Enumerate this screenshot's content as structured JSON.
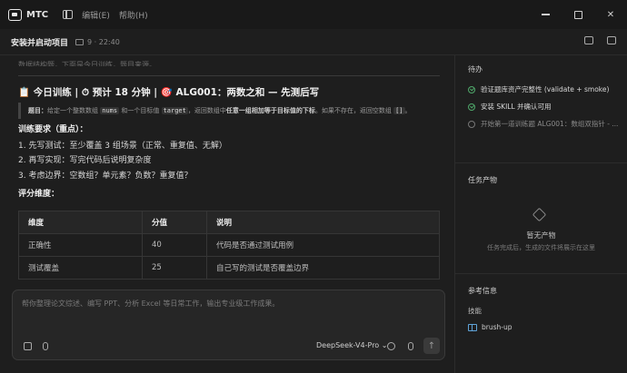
{
  "titlebar": {
    "app_name": "MTC",
    "menu": [
      "编辑(E)",
      "帮助(H)"
    ]
  },
  "subheader": {
    "title": "安装并启动项目",
    "meta": "9 · 22:40"
  },
  "main": {
    "cut_line": "数据结构题，下面是今日训练，题目来源。",
    "heading": "📋 今日训练 | ⏱ 预计 18 分钟 | 🎯 ALG001：两数之和 — 先测后写",
    "quote": {
      "label": "题目：",
      "part1": "给定一个整数数组",
      "code1": "nums",
      "part2": "和一个目标值",
      "code2": "target",
      "part3": "，返回数组中",
      "bold": "任意一组相加等于目标值的下标",
      "part4": "。如果不存在，返回空数组",
      "code3": "[]",
      "part5": "。"
    },
    "requirements_label": "训练要求（重点）：",
    "requirements": [
      "1. 先写测试：至少覆盖 3 组场景（正常、重复值、无解）",
      "2. 再写实现：写完代码后说明复杂度",
      "3. 考虑边界：空数组？单元素？负数？重复值？"
    ],
    "scoring_label": "评分维度：",
    "table": {
      "headers": [
        "维度",
        "分值",
        "说明"
      ],
      "rows": [
        [
          "正确性",
          "40",
          "代码是否通过测试用例"
        ],
        [
          "测试覆盖",
          "25",
          "自己写的测试是否覆盖边界"
        ]
      ]
    }
  },
  "input": {
    "placeholder": "帮你整理论文综述、编写 PPT、分析 Excel 等日常工作，输出专业级工作成果。",
    "model": "DeepSeek-V4-Pro ⌄"
  },
  "right_panel": {
    "todo_title": "待办",
    "todos": [
      {
        "text": "验证题库资产完整性 (validate + smoke)",
        "done": true
      },
      {
        "text": "安装 SKILL 并确认可用",
        "done": true
      },
      {
        "text": "开始第一道训练题 ALG001：数组双指针 - ...",
        "done": false
      }
    ],
    "artifacts_title": "任务产物",
    "empty_title": "暂无产物",
    "empty_sub": "任务完成后，生成的文件将展示在这里",
    "reference_title": "参考信息",
    "skill_label": "技能",
    "skill_item": "brush-up"
  },
  "colors": {
    "background": "#1e1e1e",
    "done_check": "#4fa86a",
    "skill_icon": "#5fa3d8"
  }
}
